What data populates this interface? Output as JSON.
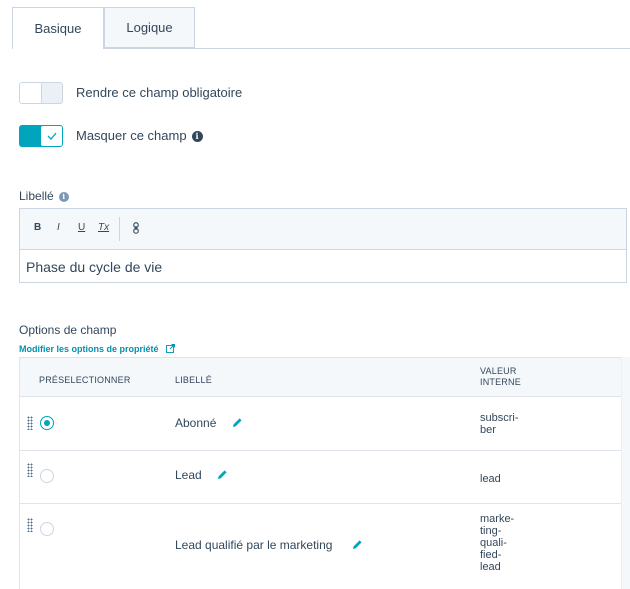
{
  "tabs": [
    {
      "label": "Basique",
      "active": true
    },
    {
      "label": "Logique",
      "active": false
    }
  ],
  "toggles": {
    "required": {
      "label": "Rendre ce champ obligatoire",
      "on": false
    },
    "hidden": {
      "label": "Masquer ce champ",
      "on": true
    }
  },
  "label_field": {
    "title": "Libellé",
    "value": "Phase du cycle de vie",
    "toolbar": {
      "bold": "B",
      "italic": "I",
      "underline": "U",
      "clear": "Tx"
    }
  },
  "options": {
    "title": "Options de champ",
    "edit_link": "Modifier les options de propriété",
    "headers": {
      "preselect": "PRÉSELECTIONNER",
      "label": "LIBELLÉ",
      "value_line1": "VALEUR",
      "value_line2": "INTERNE"
    },
    "rows": [
      {
        "label": "Abonné",
        "selected": true,
        "value_lines": [
          "subscri-",
          "ber"
        ]
      },
      {
        "label": "Lead",
        "selected": false,
        "value_lines": [
          "lead"
        ]
      },
      {
        "label": "Lead qualifié par le marketing",
        "selected": false,
        "value_lines": [
          "marke-",
          "ting-",
          "quali-",
          "fied-",
          "lead"
        ]
      }
    ]
  },
  "colors": {
    "accent": "#00a4bd",
    "link": "#0091ae",
    "text": "#33475b",
    "border": "#cbd6e2"
  },
  "icons": [
    "check-icon",
    "info-icon",
    "link-icon",
    "external-link-icon",
    "pencil-icon",
    "drag-handle-icon"
  ]
}
